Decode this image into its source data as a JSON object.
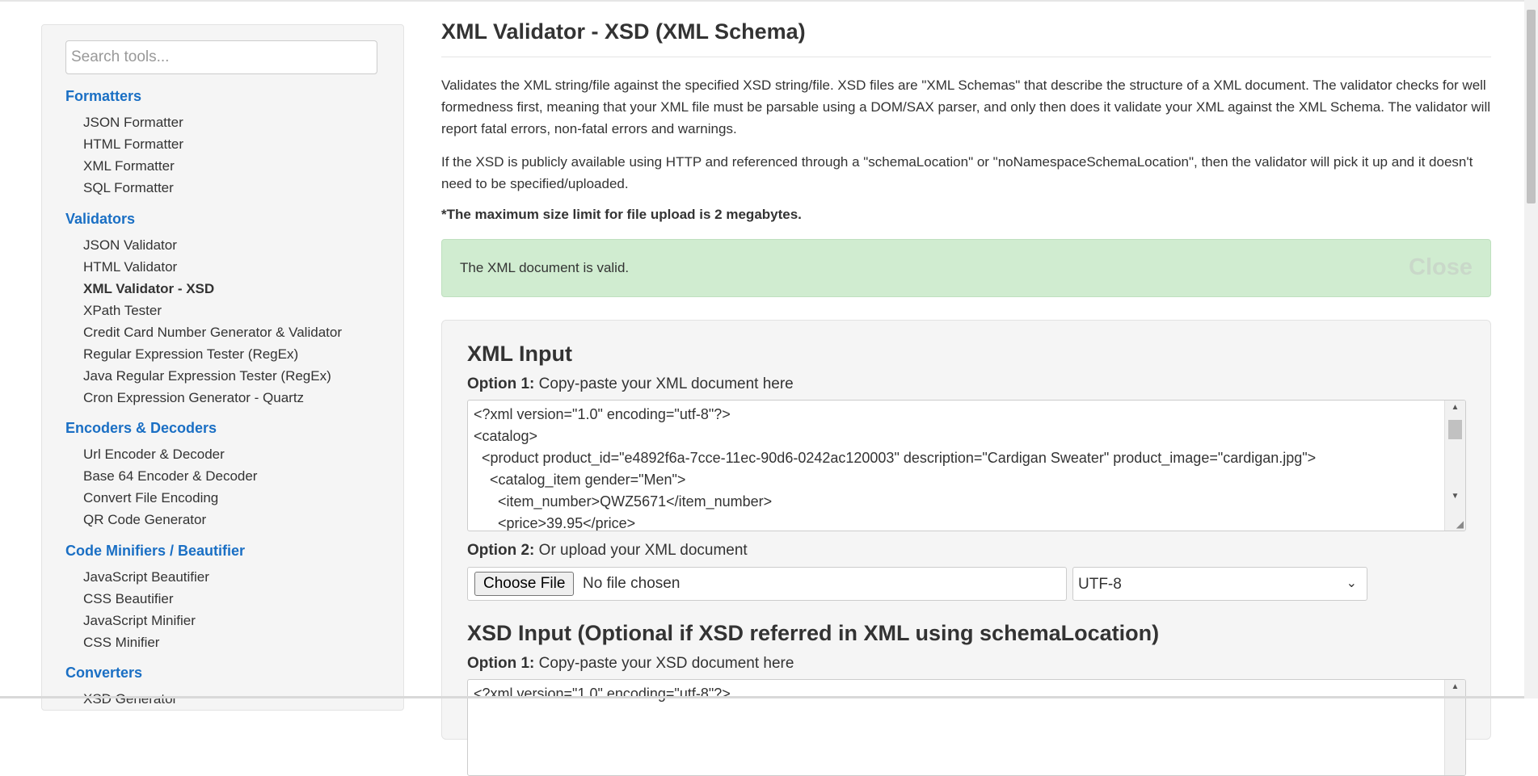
{
  "sidebar": {
    "search_placeholder": "Search tools...",
    "categories": [
      {
        "label": "Formatters",
        "items": [
          "JSON Formatter",
          "HTML Formatter",
          "XML Formatter",
          "SQL Formatter"
        ]
      },
      {
        "label": "Validators",
        "items": [
          "JSON Validator",
          "HTML Validator",
          "XML Validator - XSD",
          "XPath Tester",
          "Credit Card Number Generator & Validator",
          "Regular Expression Tester (RegEx)",
          "Java Regular Expression Tester (RegEx)",
          "Cron Expression Generator - Quartz"
        ]
      },
      {
        "label": "Encoders & Decoders",
        "items": [
          "Url Encoder & Decoder",
          "Base 64 Encoder & Decoder",
          "Convert File Encoding",
          "QR Code Generator"
        ]
      },
      {
        "label": "Code Minifiers / Beautifier",
        "items": [
          "JavaScript Beautifier",
          "CSS Beautifier",
          "JavaScript Minifier",
          "CSS Minifier"
        ]
      },
      {
        "label": "Converters",
        "items": [
          "XSD Generator"
        ]
      }
    ]
  },
  "main": {
    "title": "XML Validator - XSD (XML Schema)",
    "para1": "Validates the XML string/file against the specified XSD string/file. XSD files are \"XML Schemas\" that describe the structure of a XML document. The validator checks for well formedness first, meaning that your XML file must be parsable using a DOM/SAX parser, and only then does it validate your XML against the XML Schema. The validator will report fatal errors, non-fatal errors and warnings.",
    "para2": "If the XSD is publicly available using HTTP and referenced through a \"schemaLocation\" or \"noNamespaceSchemaLocation\", then the validator will pick it up and it doesn't need to be specified/uploaded.",
    "note": "*The maximum size limit for file upload is 2 megabytes.",
    "alert": {
      "text": "The XML document is valid.",
      "close": "Close"
    },
    "xml_input": {
      "title": "XML Input",
      "option1_label": "Option 1:",
      "option1_text": "Copy-paste your XML document here",
      "code_lines": [
        "<?xml version=\"1.0\" encoding=\"utf-8\"?>",
        "<catalog>",
        "  <product product_id=\"e4892f6a-7cce-11ec-90d6-0242ac120003\" description=\"Cardigan Sweater\" product_image=\"cardigan.jpg\">",
        "    <catalog_item gender=\"Men\">",
        "      <item_number>QWZ5671</item_number>",
        "      <price>39.95</price>"
      ],
      "option2_label": "Option 2:",
      "option2_text": "Or upload your XML document",
      "file_button": "Choose File",
      "file_status": "No file chosen",
      "encoding": "UTF-8"
    },
    "xsd_input": {
      "title": "XSD Input (Optional if XSD referred in XML using schemaLocation)",
      "option1_label": "Option 1:",
      "option1_text": "Copy-paste your XSD document here",
      "code_lines": [
        "<?xml version=\"1.0\" encoding=\"utf-8\"?>"
      ]
    }
  }
}
